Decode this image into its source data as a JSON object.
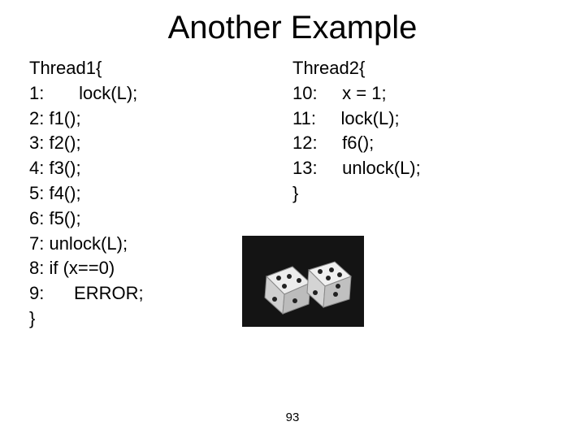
{
  "title": "Another Example",
  "left": {
    "header": "Thread1{",
    "l1": "1:       lock(L);",
    "l2": "2: f1();",
    "l3": "3: f2();",
    "l4": "4: f3();",
    "l5": "5: f4();",
    "l6": "6: f5();",
    "l7": "7: unlock(L);",
    "l8": "8: if (x==0)",
    "l9": "9:      ERROR;",
    "close": "}"
  },
  "right": {
    "header": "Thread2{",
    "l10": "10:     x = 1;",
    "l11": "11:     lock(L);",
    "l12": "12:     f6();",
    "l13": "13:     unlock(L);",
    "close": "}"
  },
  "page": "93"
}
